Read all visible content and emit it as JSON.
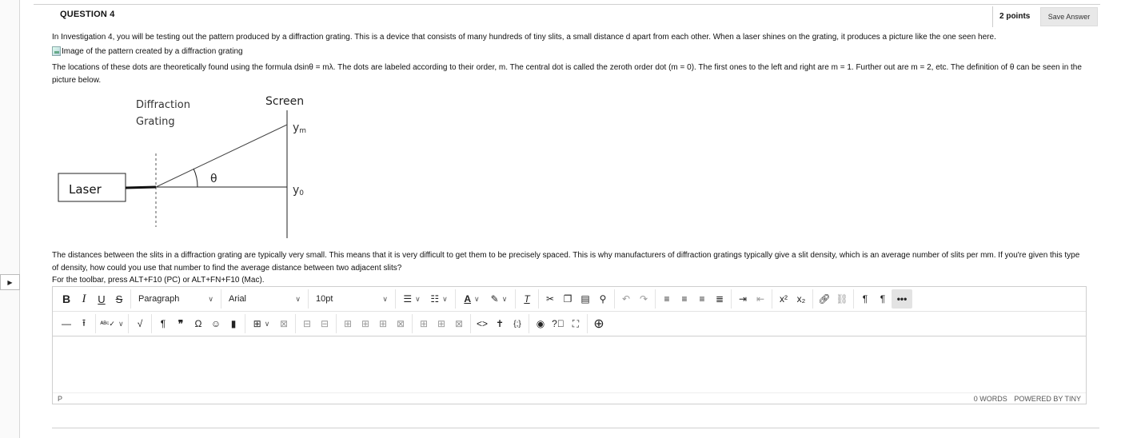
{
  "question": {
    "title": "QUESTION 4",
    "points": "2 points",
    "save_label": "Save Answer"
  },
  "content": {
    "p1": "In Investigation 4, you will be testing out the pattern produced by a diffraction grating. This is a device that consists of many hundreds of tiny slits, a small distance d apart from each other. When a laser shines on the grating, it produces a picture like the one seen here.",
    "broken_image_alt": "Image of the pattern created by a diffraction grating",
    "p2": "The locations of these dots are theoretically found using the formula dsinθ = mλ. The dots are labeled according to their order, m. The central dot is called the zeroth order dot (m = 0). The first ones to the left and right are m = 1. Further out are m = 2, etc. The definition of θ can be seen in the picture below.",
    "p3": "The distances between the slits in a diffraction grating are typically very small. This means that it is very difficult to get them to be precisely spaced. This is why manufacturers of diffraction gratings typically give a slit density, which is an average number of slits per mm. If you're given this type of density, how could you use that number to find the average distance between two adjacent slits?",
    "p4": "For the toolbar, press ALT+F10 (PC) or ALT+FN+F10 (Mac)."
  },
  "diagram": {
    "grating_line1": "Diffraction",
    "grating_line2": "Grating",
    "screen": "Screen",
    "laser": "Laser",
    "theta": "θ",
    "ym": "y",
    "ym_sub": "m",
    "y0": "y",
    "y0_sub": "0"
  },
  "editor": {
    "bold": "B",
    "italic": "I",
    "underline": "U",
    "strike": "S",
    "block_format": "Paragraph",
    "font_family": "Arial",
    "font_size": "10pt",
    "superscript": "x²",
    "subscript": "x₂",
    "more": "•••",
    "status_path": "P",
    "word_count": "0 WORDS",
    "powered_by": "POWERED BY TINY"
  }
}
